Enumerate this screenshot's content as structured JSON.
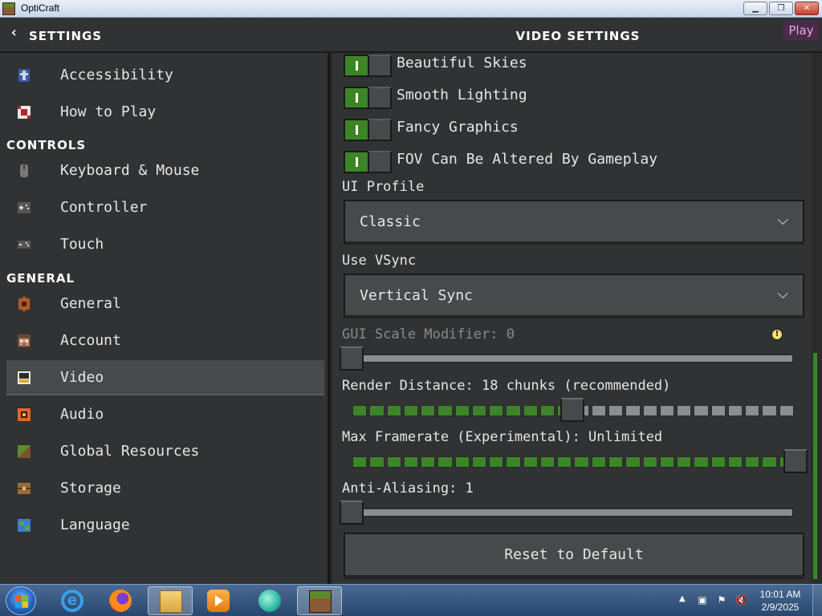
{
  "window": {
    "title": "OptiCraft",
    "min_glyph": "▁",
    "max_glyph": "❐",
    "close_glyph": "✕"
  },
  "header": {
    "back_glyph": "‹",
    "title": "SETTINGS",
    "right_title": "VIDEO SETTINGS",
    "play_label": "Play"
  },
  "sidebar": {
    "top_items": [
      {
        "label": "Accessibility",
        "icon": "accessibility-icon"
      },
      {
        "label": "How to Play",
        "icon": "how-to-play-icon"
      }
    ],
    "sections": [
      {
        "title": "CONTROLS",
        "items": [
          {
            "label": "Keyboard & Mouse",
            "icon": "mouse-icon"
          },
          {
            "label": "Controller",
            "icon": "controller-icon"
          },
          {
            "label": "Touch",
            "icon": "touch-icon"
          }
        ]
      },
      {
        "title": "GENERAL",
        "items": [
          {
            "label": "General",
            "icon": "gear-icon"
          },
          {
            "label": "Account",
            "icon": "account-icon"
          },
          {
            "label": "Video",
            "icon": "video-icon",
            "selected": true
          },
          {
            "label": "Audio",
            "icon": "audio-icon"
          },
          {
            "label": "Global Resources",
            "icon": "global-resources-icon"
          },
          {
            "label": "Storage",
            "icon": "storage-icon"
          },
          {
            "label": "Language",
            "icon": "globe-icon"
          }
        ]
      }
    ]
  },
  "video": {
    "toggles": [
      {
        "label": "Beautiful Skies",
        "on": true
      },
      {
        "label": "Smooth Lighting",
        "on": true
      },
      {
        "label": "Fancy Graphics",
        "on": true
      },
      {
        "label": "FOV Can Be Altered By Gameplay",
        "on": true
      }
    ],
    "ui_profile": {
      "label": "UI Profile",
      "value": "Classic"
    },
    "vsync": {
      "label": "Use VSync",
      "value": "Vertical Sync"
    },
    "gui_scale": {
      "label": "GUI Scale Modifier: 0",
      "fraction": 0,
      "disabled": true,
      "info_glyph": "!"
    },
    "render_distance": {
      "label": "Render Distance: 18 chunks (recommended)",
      "segments": 26,
      "filled": 13
    },
    "max_framerate": {
      "label": "Max Framerate (Experimental): Unlimited",
      "segments": 26,
      "filled": 26
    },
    "anti_aliasing": {
      "label": "Anti-Aliasing: 1",
      "fraction": 0
    },
    "reset_label": "Reset to Default"
  },
  "taskbar": {
    "clock_time": "10:01 AM",
    "clock_date": "2/9/2025",
    "ie_glyph": "e",
    "tray_arrow": "▲",
    "tray_network": "▣",
    "tray_flag": "⚑",
    "tray_volume": "🔇"
  },
  "colors": {
    "accent_green": "#3c8527",
    "panel": "#313233",
    "button": "#48494a",
    "dark": "#1e1e1f"
  }
}
